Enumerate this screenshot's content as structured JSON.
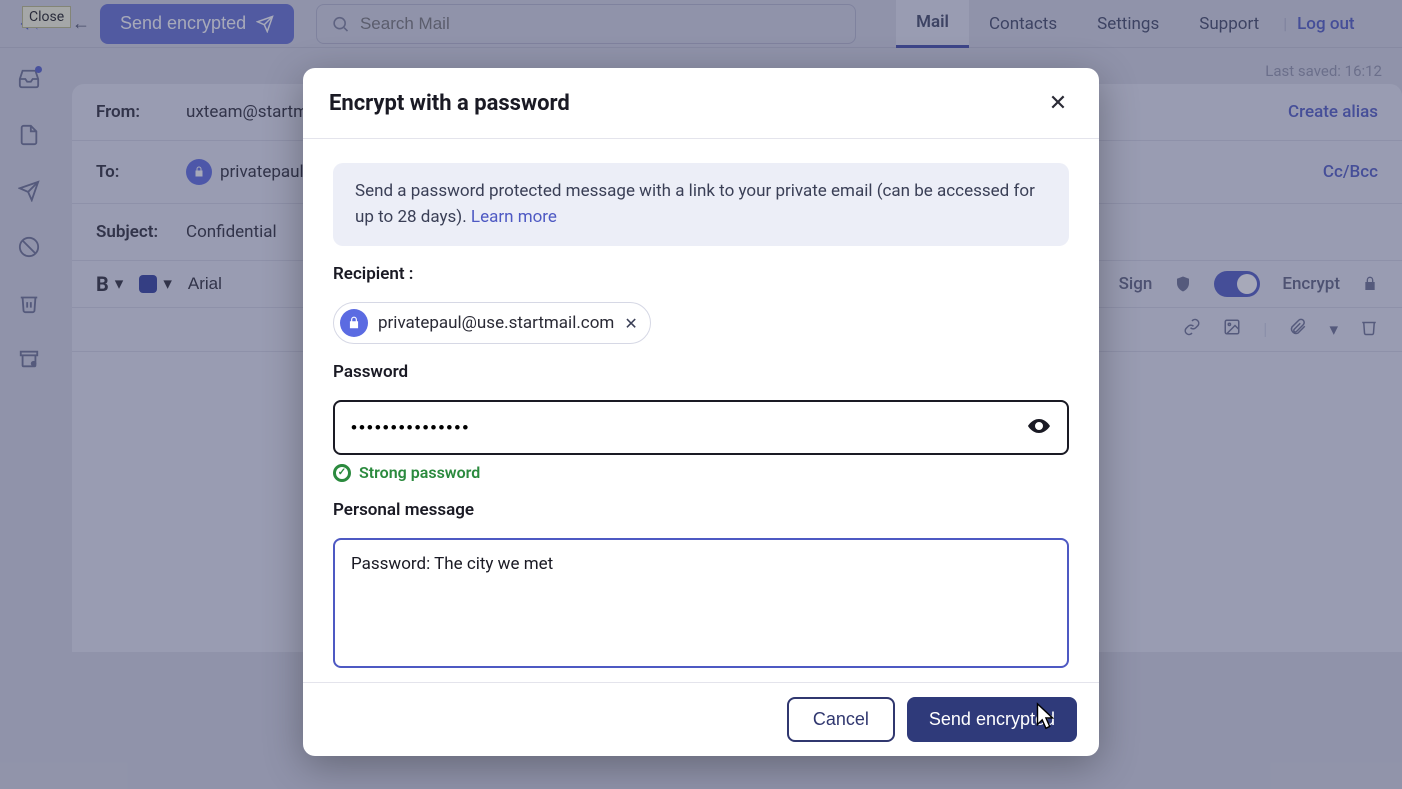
{
  "tooltip": {
    "close": "Close"
  },
  "topbar": {
    "send_label": "Send encrypted",
    "search_placeholder": "Search Mail"
  },
  "nav": {
    "mail": "Mail",
    "contacts": "Contacts",
    "settings": "Settings",
    "support": "Support",
    "logout": "Log out"
  },
  "compose": {
    "last_saved": "Last saved: 16:12",
    "from_label": "From:",
    "from_value": "uxteam@startma",
    "create_alias": "Create alias",
    "to_label": "To:",
    "to_value": "privatepaul",
    "ccbcc": "Cc/Bcc",
    "subject_label": "Subject:",
    "subject_value": "Confidential",
    "font_name": "Arial",
    "toggle_sign": "Sign",
    "toggle_encrypt": "Encrypt"
  },
  "modal": {
    "title": "Encrypt with a password",
    "info": "Send a password protected message with a link to your private email (can be accessed for up to 28 days). ",
    "learn_more": "Learn more",
    "recipient_label": "Recipient :",
    "recipient_value": "privatepaul@use.startmail.com",
    "password_label": "Password",
    "password_value": "•••••••••••••••",
    "strength": "Strong password",
    "personal_label": "Personal message",
    "personal_value": "Password: The city we met",
    "cancel": "Cancel",
    "send": "Send encrypted"
  }
}
